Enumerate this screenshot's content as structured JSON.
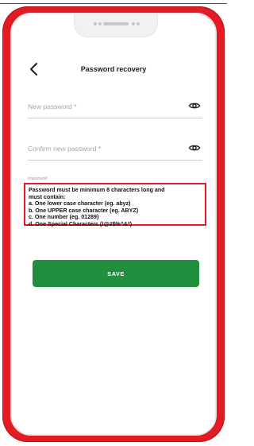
{
  "header": {
    "title": "Password recovery"
  },
  "form": {
    "new_password_placeholder": "New password *",
    "confirm_password_placeholder": "Confirm new password *"
  },
  "requirements": {
    "label": "Important!",
    "lines": [
      "Password must be minimum 8 characters long and",
      "must contain:",
      "a. One lower case character (eg. abyz)",
      "b. One UPPER case character (eg. ABYZ)",
      "c. One number (eg. 01289)",
      "d. One Special Characters (!@#$%^&*)"
    ]
  },
  "actions": {
    "save_label": "SAVE"
  },
  "colors": {
    "frame": "#e31b23",
    "button": "#1f8f3e",
    "highlight": "#e31b23"
  },
  "icons": {
    "back": "chevron-left-icon",
    "reveal": "eye-icon"
  }
}
